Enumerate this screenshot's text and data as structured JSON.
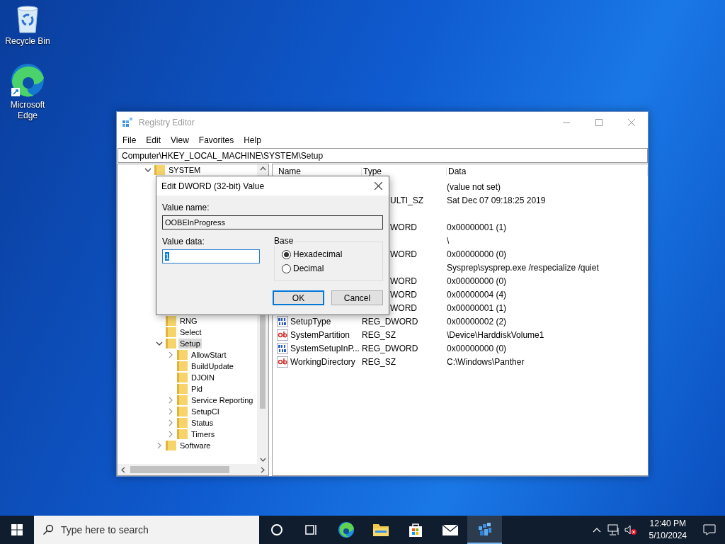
{
  "desktop_icons": [
    {
      "kind": "recycle",
      "label": "Recycle Bin"
    },
    {
      "kind": "edge",
      "label": "Microsoft Edge"
    }
  ],
  "window": {
    "title": "Registry Editor",
    "menu": [
      "File",
      "Edit",
      "View",
      "Favorites",
      "Help"
    ],
    "address": "Computer\\HKEY_LOCAL_MACHINE\\SYSTEM\\Setup",
    "tree": [
      {
        "label": "SYSTEM",
        "kind": "open",
        "selected": false,
        "children": [
          {
            "label": "RNG",
            "kind": "leaf",
            "selected": false
          },
          {
            "label": "Select",
            "kind": "leaf",
            "selected": false
          },
          {
            "label": "Setup",
            "kind": "open",
            "selected": true,
            "children": [
              {
                "label": "AllowStart",
                "kind": "closed",
                "selected": false
              },
              {
                "label": "BuildUpdate",
                "kind": "leaf",
                "selected": false
              },
              {
                "label": "DJOIN",
                "kind": "leaf",
                "selected": false
              },
              {
                "label": "Pid",
                "kind": "leaf",
                "selected": false
              },
              {
                "label": "Service Reporting",
                "kind": "closed",
                "selected": false
              },
              {
                "label": "SetupCI",
                "kind": "closed",
                "selected": false
              },
              {
                "label": "Status",
                "kind": "closed",
                "selected": false
              },
              {
                "label": "Timers",
                "kind": "closed",
                "selected": false
              }
            ]
          },
          {
            "label": "Software",
            "kind": "closed",
            "selected": false
          }
        ]
      }
    ],
    "columns": [
      "Name",
      "Type",
      "Data"
    ],
    "rows": [
      {
        "data": "(value not set)"
      },
      {
        "type": "ULTI_SZ",
        "data": "Sat Dec 07 09:18:25 2019"
      },
      {},
      {
        "type": "WORD",
        "data": "0x00000001 (1)"
      },
      {
        "data": "\\"
      },
      {
        "type": "WORD",
        "data": "0x00000000 (0)"
      },
      {
        "data": "Sysprep\\sysprep.exe /respecialize /quiet"
      },
      {
        "type": "WORD",
        "data": "0x00000000 (0)"
      },
      {
        "type": "WORD",
        "data": "0x00000004 (4)"
      },
      {
        "type": "WORD",
        "data": "0x00000001 (1)"
      },
      {
        "kind": "dword",
        "name": "SetupType",
        "type": "REG_DWORD",
        "data": "0x00000002 (2)"
      },
      {
        "kind": "sz",
        "name": "SystemPartition",
        "type": "REG_SZ",
        "data": "\\Device\\HarddiskVolume1"
      },
      {
        "kind": "dword",
        "name": "SystemSetupInP...",
        "type": "REG_DWORD",
        "data": "0x00000000 (0)"
      },
      {
        "kind": "sz",
        "name": "WorkingDirectory",
        "type": "REG_SZ",
        "data": "C:\\Windows\\Panther"
      }
    ]
  },
  "dialog": {
    "title": "Edit DWORD (32-bit) Value",
    "name_label": "Value name:",
    "name_value": "OOBEInProgress",
    "data_label": "Value data:",
    "data_value": "1",
    "data_text_selected": true,
    "base_label": "Base",
    "base_options": [
      {
        "label": "Hexadecimal",
        "selected": true
      },
      {
        "label": "Decimal",
        "selected": false
      }
    ],
    "buttons": [
      {
        "label": "OK",
        "focused": true
      },
      {
        "label": "Cancel",
        "focused": false
      }
    ]
  },
  "taskbar": {
    "search_placeholder": "Type here to search",
    "apps": [
      {
        "kind": "cortana",
        "active": false
      },
      {
        "kind": "taskview",
        "active": false
      },
      {
        "kind": "edge",
        "active": false
      },
      {
        "kind": "explorer",
        "active": false
      },
      {
        "kind": "store",
        "active": false
      },
      {
        "kind": "mail",
        "active": false
      },
      {
        "kind": "regedit",
        "active": true
      }
    ],
    "clock": {
      "time": "12:40 PM",
      "date": "5/10/2024"
    }
  }
}
